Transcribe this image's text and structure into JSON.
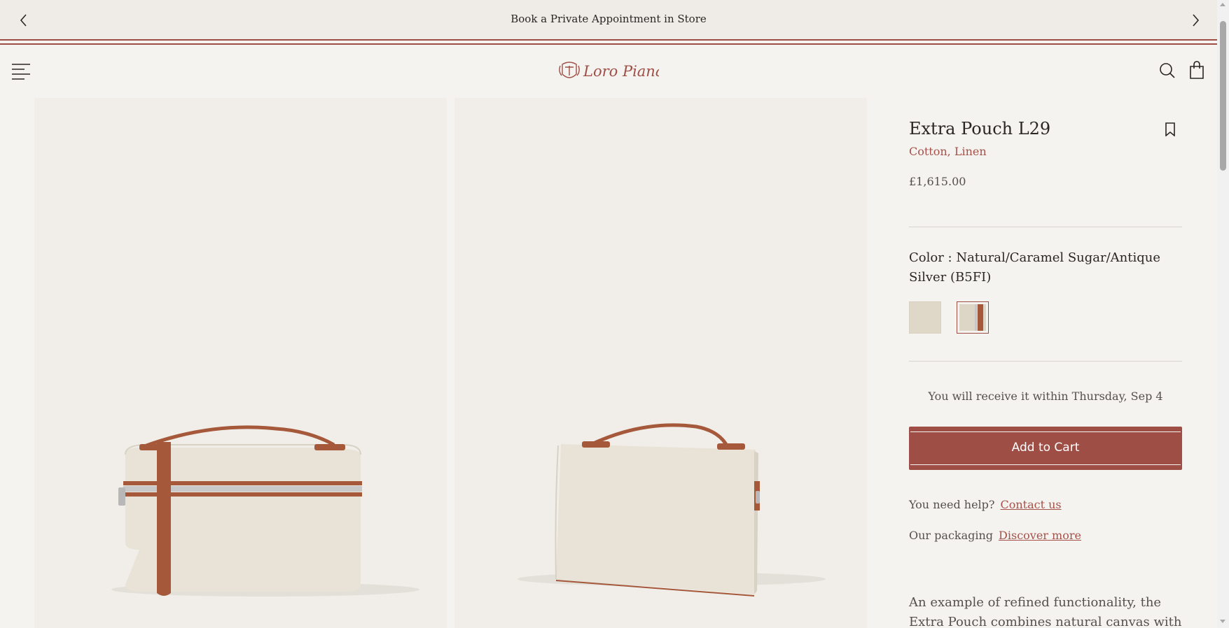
{
  "announcement": {
    "text": "Book a Private Appointment in Store"
  },
  "header": {
    "brand": "Loro Piana",
    "icons": [
      "menu-icon",
      "search-icon",
      "shopping-bag-icon"
    ]
  },
  "product": {
    "title": "Extra Pouch L29",
    "material": "Cotton, Linen",
    "price": "£1,615.00",
    "color_label": "Color : Natural/Caramel Sugar/Antique Silver (B5FI)",
    "swatches": [
      "natural-swatch",
      "natural-caramel-swatch"
    ],
    "selected_swatch_index": 1,
    "delivery": "You will receive it within Thursday, Sep 4",
    "add_to_cart": "Add to Cart",
    "help_text": "You need help?",
    "help_link": "Contact us",
    "packaging_text": "Our packaging",
    "packaging_link": "Discover more",
    "description": "An example of refined functionality, the Extra Pouch combines natural canvas with supple"
  },
  "colors": {
    "accent": "#9e4e45",
    "link": "#a5524a",
    "background": "#f5f3ef",
    "panel": "#f1eeea"
  }
}
